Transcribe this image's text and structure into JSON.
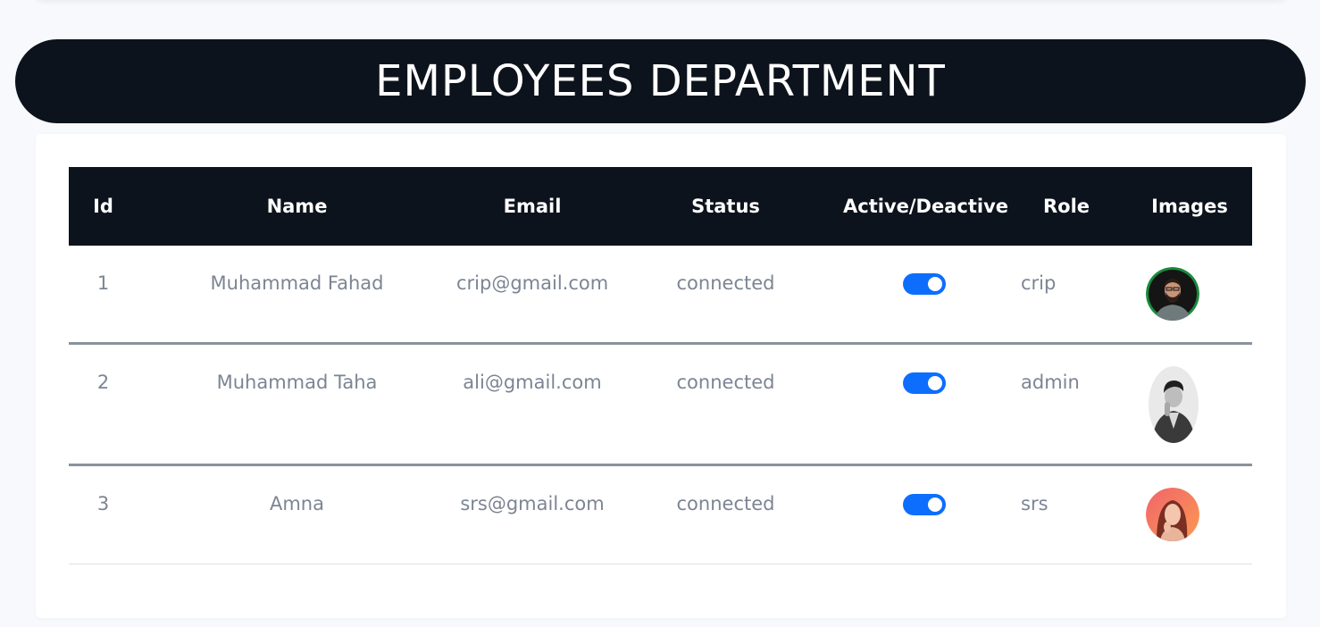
{
  "page": {
    "title": "EMPLOYEES DEPARTMENT"
  },
  "table": {
    "headers": [
      "Id",
      "Name",
      "Email",
      "Status",
      "Active/Deactive",
      "Role",
      "Images"
    ],
    "rows": [
      {
        "id": "1",
        "name": "Muhammad Fahad",
        "email": "crip@gmail.com",
        "status": "connected",
        "active": true,
        "role": "crip",
        "image": "man-with-beard-avatar"
      },
      {
        "id": "2",
        "name": "Muhammad Taha",
        "email": "ali@gmail.com",
        "status": "connected",
        "active": true,
        "role": "admin",
        "image": "man-in-suit-avatar"
      },
      {
        "id": "3",
        "name": "Amna",
        "email": "srs@gmail.com",
        "status": "connected",
        "active": true,
        "role": "srs",
        "image": "woman-avatar"
      }
    ]
  },
  "colors": {
    "header_bg": "#0d131c",
    "toggle_on": "#0d6efd",
    "cell_text": "#7c8593",
    "page_bg": "#f8f9fd"
  }
}
